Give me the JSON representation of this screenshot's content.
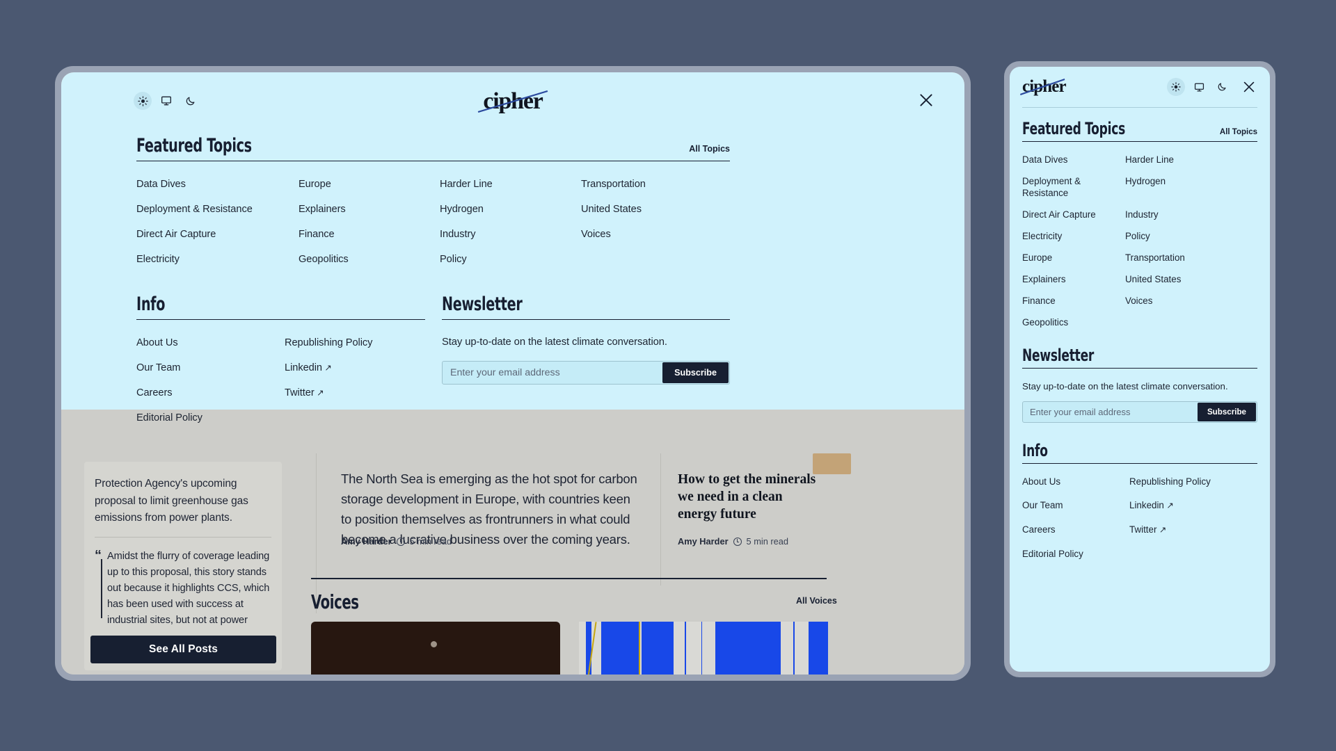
{
  "brand": {
    "name": "cipher"
  },
  "theme_toggle": {
    "light_label": "Light theme",
    "system_label": "System theme",
    "dark_label": "Dark theme",
    "active": "light"
  },
  "close_label": "Close menu",
  "colors": {
    "panel_bg": "#d0f2fc",
    "ink": "#171f31",
    "window_chrome": "#9aa3b4",
    "desktop_bg": "#4b5871",
    "accent_blue": "#1848e8",
    "page_bg": "#cdcdc9"
  },
  "featured_topics": {
    "title": "Featured Topics",
    "all_link": "All Topics",
    "desktop_columns": [
      [
        "Data Dives",
        "Deployment & Resistance",
        "Direct Air Capture",
        "Electricity"
      ],
      [
        "Europe",
        "Explainers",
        "Finance",
        "Geopolitics"
      ],
      [
        "Harder Line",
        "Hydrogen",
        "Industry",
        "Policy"
      ],
      [
        "Transportation",
        "United States",
        "Voices"
      ]
    ],
    "mobile_columns": [
      [
        "Data Dives",
        "Deployment & Resistance",
        "Direct Air Capture",
        "Electricity",
        "Europe",
        "Explainers",
        "Finance",
        "Geopolitics"
      ],
      [
        "Harder Line",
        "Hydrogen",
        "Industry",
        "Policy",
        "Transportation",
        "United States",
        "Voices"
      ]
    ]
  },
  "info": {
    "title": "Info",
    "columns": [
      [
        {
          "label": "About Us",
          "external": false
        },
        {
          "label": "Our Team",
          "external": false
        },
        {
          "label": "Careers",
          "external": false
        },
        {
          "label": "Editorial Policy",
          "external": false
        }
      ],
      [
        {
          "label": "Republishing Policy",
          "external": false
        },
        {
          "label": "Linkedin",
          "external": true
        },
        {
          "label": "Twitter",
          "external": true
        }
      ]
    ]
  },
  "newsletter": {
    "title": "Newsletter",
    "description": "Stay up-to-date on the latest climate conversation.",
    "email_placeholder": "Enter your email address",
    "email_value": "",
    "subscribe_label": "Subscribe"
  },
  "background_page": {
    "left_card": {
      "paragraph": "Protection Agency's upcoming proposal to limit greenhouse gas emissions from power plants.",
      "quote": "Amidst the flurry of coverage leading up to this proposal, this story stands out because it highlights CCS, which has been used with success at industrial sites, but not at power",
      "button_label": "See All Posts"
    },
    "center_article": {
      "dek": "The North Sea is emerging as the hot spot for carbon storage development in Europe, with countries keen to position themselves as frontrunners in what could become a lucrative business over the coming years.",
      "author": "Amy Harder",
      "read_time": "5 min read"
    },
    "right_article": {
      "title": "How to get the minerals we need in a clean energy future",
      "author": "Amy Harder",
      "read_time": "5 min read"
    },
    "voices": {
      "title": "Voices",
      "all_link": "All Voices"
    }
  }
}
